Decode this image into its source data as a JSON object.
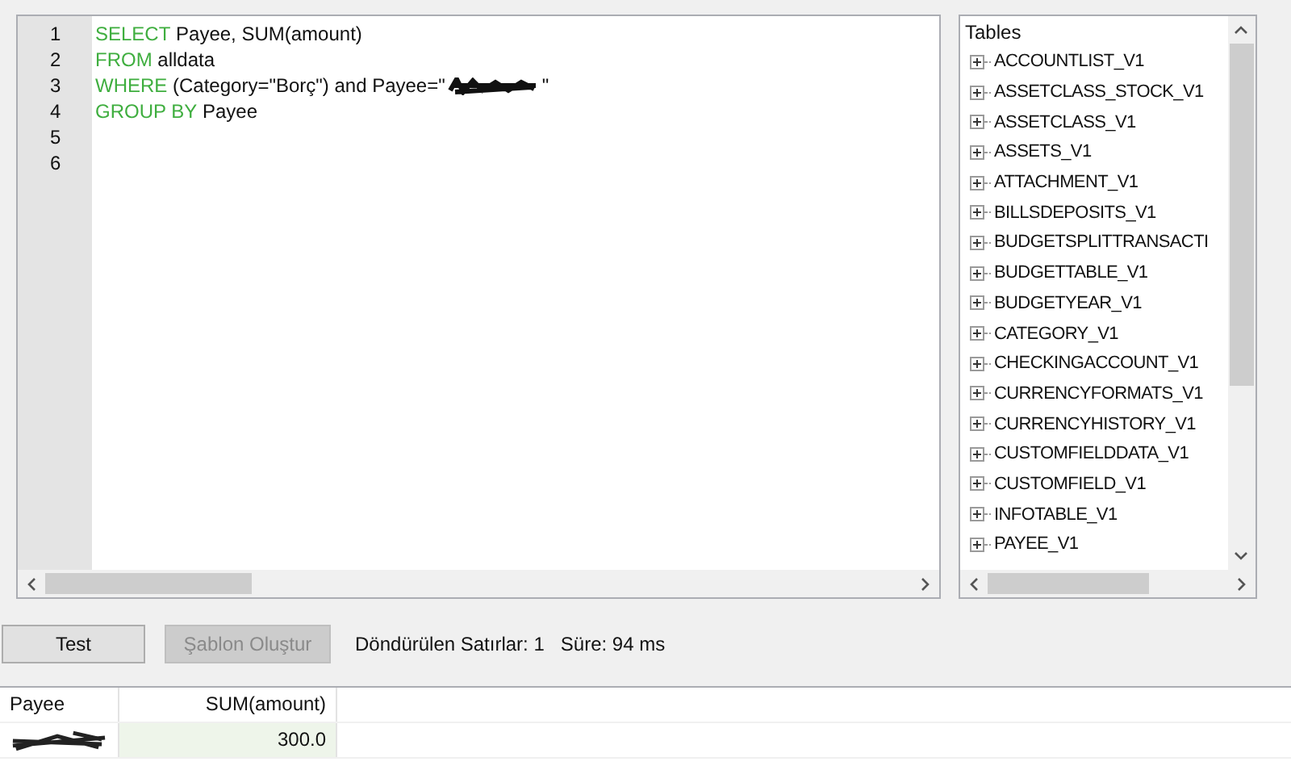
{
  "editor": {
    "lines": [
      {
        "number": "1",
        "segments": [
          {
            "kind": "keyword",
            "text": "SELECT"
          },
          {
            "kind": "text",
            "text": " Payee, SUM(amount)"
          }
        ]
      },
      {
        "number": "2",
        "segments": [
          {
            "kind": "keyword",
            "text": "FROM"
          },
          {
            "kind": "text",
            "text": " alldata"
          }
        ]
      },
      {
        "number": "3",
        "segments": [
          {
            "kind": "keyword",
            "text": "WHERE"
          },
          {
            "kind": "text",
            "text": " (Category=\"Borç\") and Payee=\""
          },
          {
            "kind": "redacted"
          },
          {
            "kind": "text",
            "text": "\""
          }
        ]
      },
      {
        "number": "4",
        "segments": [
          {
            "kind": "keyword",
            "text": "GROUP BY"
          },
          {
            "kind": "text",
            "text": " Payee"
          }
        ]
      },
      {
        "number": "5"
      },
      {
        "number": "6"
      }
    ]
  },
  "tables_panel": {
    "title": "Tables",
    "items": [
      {
        "label": "ACCOUNTLIST_V1",
        "expanded": false
      },
      {
        "label": "ASSETCLASS_STOCK_V1",
        "expanded": false
      },
      {
        "label": "ASSETCLASS_V1",
        "expanded": false
      },
      {
        "label": "ASSETS_V1",
        "expanded": false
      },
      {
        "label": "ATTACHMENT_V1",
        "expanded": false
      },
      {
        "label": "BILLSDEPOSITS_V1",
        "expanded": false
      },
      {
        "label": "BUDGETSPLITTRANSACTI",
        "expanded": false
      },
      {
        "label": "BUDGETTABLE_V1",
        "expanded": false
      },
      {
        "label": "BUDGETYEAR_V1",
        "expanded": false
      },
      {
        "label": "CATEGORY_V1",
        "expanded": false
      },
      {
        "label": "CHECKINGACCOUNT_V1",
        "expanded": false
      },
      {
        "label": "CURRENCYFORMATS_V1",
        "expanded": false
      },
      {
        "label": "CURRENCYHISTORY_V1",
        "expanded": false
      },
      {
        "label": "CUSTOMFIELDDATA_V1",
        "expanded": false
      },
      {
        "label": "CUSTOMFIELD_V1",
        "expanded": false
      },
      {
        "label": "INFOTABLE_V1",
        "expanded": false
      },
      {
        "label": "PAYEE_V1",
        "expanded": false
      }
    ]
  },
  "buttons": [
    {
      "label": "Test",
      "disabled": false
    },
    {
      "label": "Şablon Oluştur",
      "disabled": true
    }
  ],
  "status": {
    "rows_label": "Döndürülen Satırlar: 1",
    "time_label": "Süre: 94 ms"
  },
  "results": {
    "columns": [
      "Payee",
      "SUM(amount)"
    ],
    "rows": [
      [
        {
          "kind": "redacted"
        },
        {
          "kind": "text",
          "text": "300.0"
        }
      ]
    ]
  }
}
